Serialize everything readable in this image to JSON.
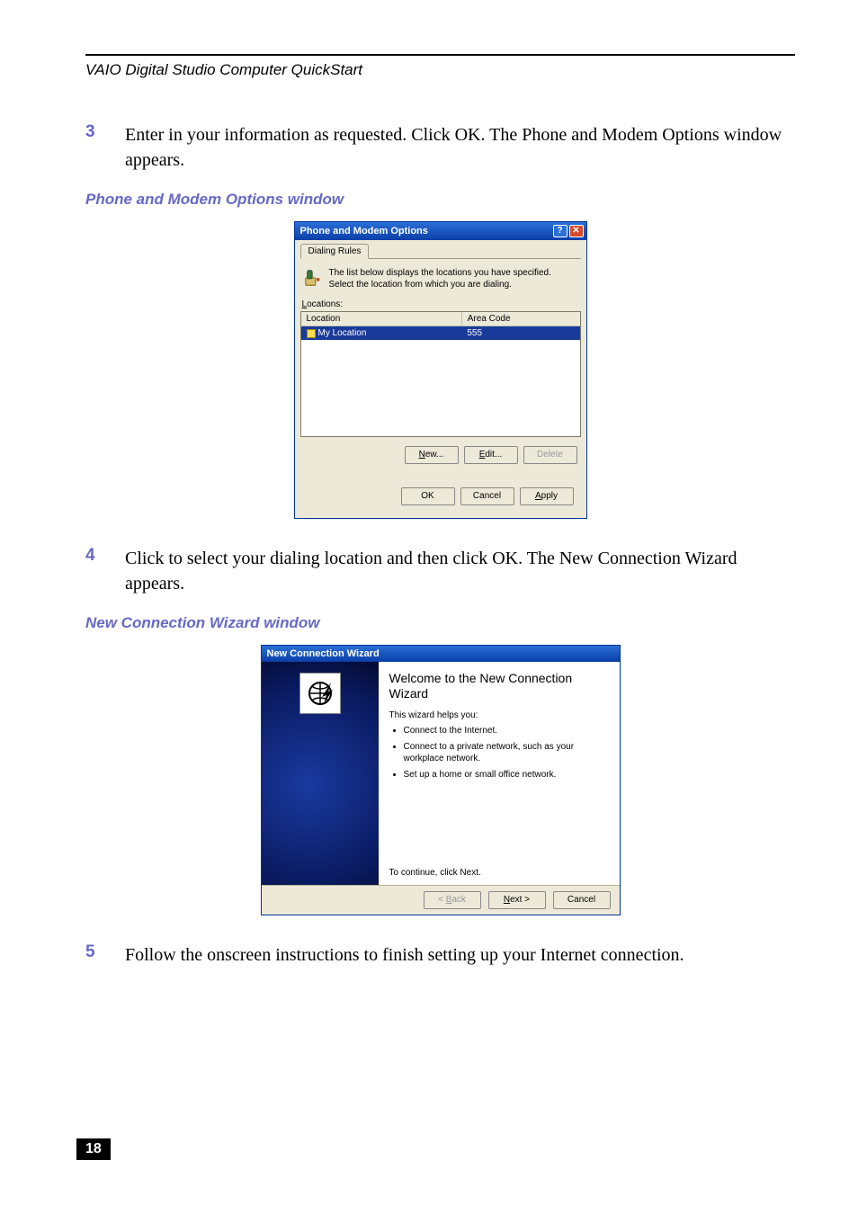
{
  "doc": {
    "header": "VAIO Digital Studio Computer QuickStart",
    "page_number": "18",
    "steps": {
      "s3": {
        "num": "3",
        "text": "Enter in your information as requested. Click OK. The Phone and Modem Options window appears."
      },
      "s4": {
        "num": "4",
        "text": "Click to select your dialing location and then click OK. The New Connection Wizard appears."
      },
      "s5": {
        "num": "5",
        "text": "Follow the onscreen instructions to finish setting up your Internet connection."
      }
    },
    "captions": {
      "phone_modem": "Phone and Modem Options window",
      "wizard": "New Connection Wizard window"
    }
  },
  "phone_modem": {
    "title": "Phone and Modem Options",
    "tab": "Dialing Rules",
    "desc": "The list below displays the locations you have specified. Select the location from which you are dialing.",
    "label_prefix": "L",
    "label_rest": "ocations:",
    "columns": {
      "location": "Location",
      "area_code": "Area Code"
    },
    "row": {
      "location": "My Location",
      "area_code": "555"
    },
    "buttons": {
      "new": "New...",
      "edit": "Edit...",
      "delete": "Delete",
      "ok": "OK",
      "cancel": "Cancel",
      "apply": "Apply"
    },
    "title_buttons": {
      "help": "?",
      "close": "✕"
    }
  },
  "wizard": {
    "title": "New Connection Wizard",
    "heading": "Welcome to the New Connection Wizard",
    "subhead": "This wizard helps you:",
    "bullets": {
      "b1": "Connect to the Internet.",
      "b2": "Connect to a private network, such as your workplace network.",
      "b3": "Set up a home or small office network."
    },
    "continue": "To continue, click Next.",
    "buttons": {
      "back": "< Back",
      "next": "Next >",
      "cancel": "Cancel"
    }
  }
}
